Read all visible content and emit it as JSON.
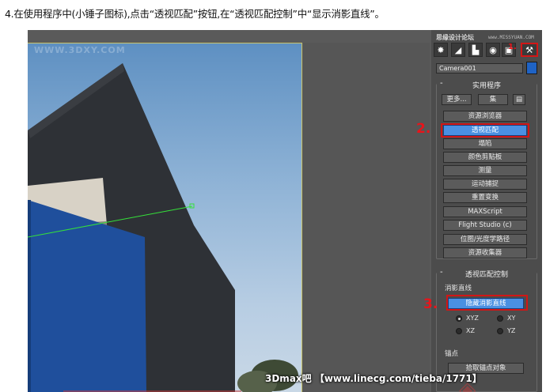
{
  "instruction": "4.在使用程序中(小锤子图标),点击“透视匹配”按钮,在“透视匹配控制”中“显示消影直线”。",
  "viewport": {
    "watermark": "WWW.3DXY.COM"
  },
  "panel": {
    "brand": "思缘设计论坛",
    "brand_url": "www.MISSYUAN.COM",
    "tabs": [
      {
        "icon": "create-icon",
        "glyph": "✸"
      },
      {
        "icon": "modify-icon",
        "glyph": "◢"
      },
      {
        "icon": "hierarchy-icon",
        "glyph": "▙"
      },
      {
        "icon": "motion-icon",
        "glyph": "◉"
      },
      {
        "icon": "display-icon",
        "glyph": "▣"
      },
      {
        "icon": "utilities-hammer-icon",
        "glyph": "⚒"
      }
    ],
    "step1": "1.",
    "object_name": "Camera001",
    "object_color": "#1f63c5",
    "utilities": {
      "title": "实用程序",
      "more_label": "更多...",
      "sets_label": "集",
      "buttons": [
        "资源浏览器",
        "透视匹配",
        "塌陷",
        "颜色剪贴板",
        "测量",
        "运动捕捉",
        "重置变换",
        "MAXScript",
        "Flight Studio (c)",
        "位图/光度学路径",
        "资源收集器"
      ],
      "active_index": 1
    },
    "step2": "2.",
    "perspective_match_control": {
      "title": "透视匹配控制",
      "group_label": "消影直线",
      "hide_button": "隐藏消影直线",
      "radios": [
        "XYZ",
        "XY",
        "XZ",
        "YZ"
      ],
      "selected": "XYZ"
    },
    "step3": "3.",
    "anchor_group": "锚点",
    "pick_anchor_button": "拾取锚点对象"
  },
  "footer_watermark": "3Dmax吧 【www.linecg.com/tieba/1771】",
  "colors": {
    "highlight_red": "#d21616",
    "active_blue": "#4a90e2",
    "panel_bg": "#4c4c4c"
  }
}
